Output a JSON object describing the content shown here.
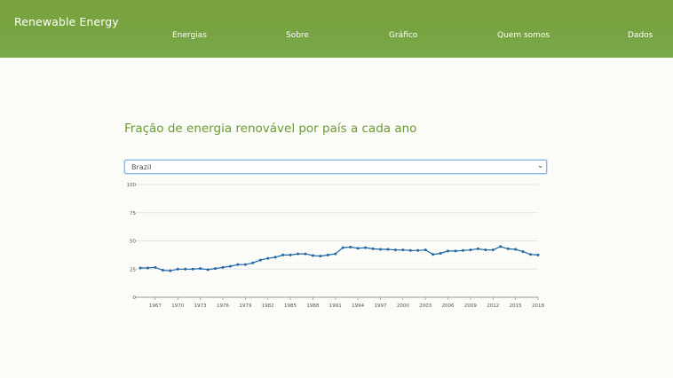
{
  "navbar": {
    "brand": "Renewable Energy",
    "links": [
      "Energias",
      "Sobre",
      "Gráfico",
      "Quem somos",
      "Dados"
    ]
  },
  "main": {
    "title": "Fração de energia renovável por país a cada ano",
    "country_select": {
      "selected": "Brazil"
    }
  },
  "colors": {
    "navbar": "#78a342",
    "title": "#6b9a34",
    "line": "#2166a8"
  },
  "chart_data": {
    "type": "line",
    "title": "",
    "xlabel": "",
    "ylabel": "",
    "ylim": [
      0,
      100
    ],
    "yticks": [
      0,
      25,
      50,
      75,
      100
    ],
    "xticks": [
      1967,
      1970,
      1973,
      1976,
      1979,
      1982,
      1985,
      1988,
      1991,
      1994,
      1997,
      2000,
      2003,
      2006,
      2009,
      2012,
      2015,
      2018
    ],
    "grid": true,
    "legend": "none",
    "series": [
      {
        "x": [
          1965,
          1966,
          1967,
          1968,
          1969,
          1970,
          1971,
          1972,
          1973,
          1974,
          1975,
          1976,
          1977,
          1978,
          1979,
          1980,
          1981,
          1982,
          1983,
          1984,
          1985,
          1986,
          1987,
          1988,
          1989,
          1990,
          1991,
          1992,
          1993,
          1994,
          1995,
          1996,
          1997,
          1998,
          1999,
          2000,
          2001,
          2002,
          2003,
          2004,
          2005,
          2006,
          2007,
          2008,
          2009,
          2010,
          2011,
          2012,
          2013,
          2014,
          2015,
          2016,
          2017,
          2018
        ],
        "values": [
          26.0,
          26.0,
          26.5,
          24.0,
          23.5,
          25.0,
          25.0,
          25.0,
          25.5,
          24.5,
          25.5,
          26.5,
          27.5,
          29.0,
          29.0,
          30.5,
          33.0,
          34.5,
          35.5,
          37.5,
          37.5,
          38.5,
          38.5,
          37.0,
          36.5,
          37.5,
          38.5,
          44.0,
          44.5,
          43.5,
          44.0,
          43.0,
          42.5,
          42.5,
          42.0,
          42.0,
          41.5,
          41.5,
          42.0,
          38.0,
          39.0,
          41.0,
          41.0,
          41.5,
          42.0,
          43.0,
          42.0,
          42.0,
          45.0,
          43.0,
          42.5,
          40.5,
          38.0,
          37.5
        ]
      }
    ]
  }
}
